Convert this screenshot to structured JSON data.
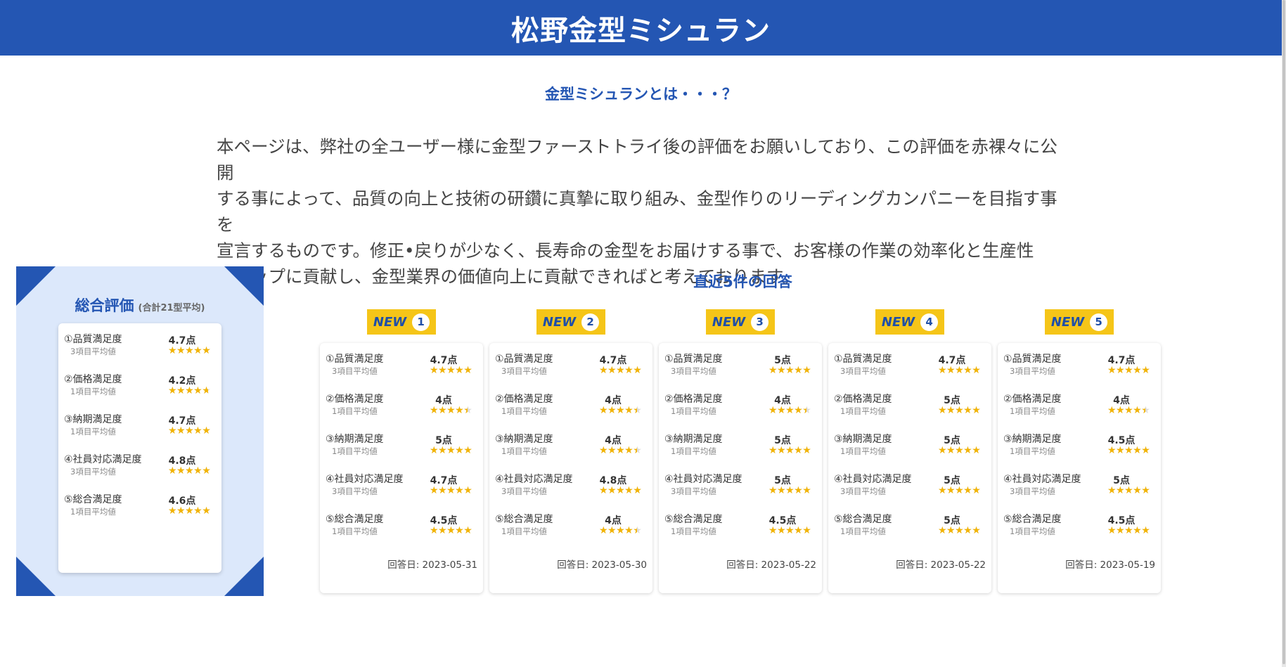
{
  "header": {
    "title": "松野金型ミシュラン"
  },
  "subtitle": "金型ミシュランとは・・・？",
  "intro": {
    "lines": [
      "本ページは、弊社の全ユーザー様に金型ファーストトライ後の評価をお願いしており、この評価を赤裸々に公開",
      "する事によって、品質の向上と技術の研鑽に真摯に取り組み、金型作りのリーディングカンパニーを目指す事を",
      "宣言するものです。修正•戻りが少なく、長寿命の金型をお届けする事で、お客様の作業の効率化と生産性",
      "のアップに貢献し、金型業界の価値向上に貢献できればと考えております。"
    ]
  },
  "overall": {
    "title": "総合評価",
    "note": "(合計21型平均)",
    "items": [
      {
        "label": "①品質満足度",
        "sub": "3項目平均値",
        "score": "4.7点",
        "value": 4.7
      },
      {
        "label": "②価格満足度",
        "sub": "1項目平均値",
        "score": "4.2点",
        "value": 4.2
      },
      {
        "label": "③納期満足度",
        "sub": "1項目平均値",
        "score": "4.7点",
        "value": 4.7
      },
      {
        "label": "④社員対応満足度",
        "sub": "3項目平均値",
        "score": "4.8点",
        "value": 4.8
      },
      {
        "label": "⑤総合満足度",
        "sub": "1項目平均値",
        "score": "4.6点",
        "value": 4.6
      }
    ]
  },
  "recent": {
    "title": "直近5件の回答",
    "new_label": "NEW",
    "cards": [
      {
        "num": "1",
        "date": "回答日: 2023-05-31",
        "items": [
          {
            "label": "①品質満足度",
            "sub": "3項目平均値",
            "score": "4.7点",
            "value": 4.7
          },
          {
            "label": "②価格満足度",
            "sub": "1項目平均値",
            "score": "4点",
            "value": 4
          },
          {
            "label": "③納期満足度",
            "sub": "1項目平均値",
            "score": "5点",
            "value": 5
          },
          {
            "label": "④社員対応満足度",
            "sub": "3項目平均値",
            "score": "4.7点",
            "value": 4.7
          },
          {
            "label": "⑤総合満足度",
            "sub": "1項目平均値",
            "score": "4.5点",
            "value": 4.5
          }
        ]
      },
      {
        "num": "2",
        "date": "回答日: 2023-05-30",
        "items": [
          {
            "label": "①品質満足度",
            "sub": "3項目平均値",
            "score": "4.7点",
            "value": 4.7
          },
          {
            "label": "②価格満足度",
            "sub": "1項目平均値",
            "score": "4点",
            "value": 4
          },
          {
            "label": "③納期満足度",
            "sub": "1項目平均値",
            "score": "4点",
            "value": 4
          },
          {
            "label": "④社員対応満足度",
            "sub": "3項目平均値",
            "score": "4.8点",
            "value": 4.8
          },
          {
            "label": "⑤総合満足度",
            "sub": "1項目平均値",
            "score": "4点",
            "value": 4
          }
        ]
      },
      {
        "num": "3",
        "date": "回答日: 2023-05-22",
        "items": [
          {
            "label": "①品質満足度",
            "sub": "3項目平均値",
            "score": "5点",
            "value": 5
          },
          {
            "label": "②価格満足度",
            "sub": "1項目平均値",
            "score": "4点",
            "value": 4
          },
          {
            "label": "③納期満足度",
            "sub": "1項目平均値",
            "score": "5点",
            "value": 5
          },
          {
            "label": "④社員対応満足度",
            "sub": "3項目平均値",
            "score": "5点",
            "value": 5
          },
          {
            "label": "⑤総合満足度",
            "sub": "1項目平均値",
            "score": "4.5点",
            "value": 4.5
          }
        ]
      },
      {
        "num": "4",
        "date": "回答日: 2023-05-22",
        "items": [
          {
            "label": "①品質満足度",
            "sub": "3項目平均値",
            "score": "4.7点",
            "value": 4.7
          },
          {
            "label": "②価格満足度",
            "sub": "1項目平均値",
            "score": "5点",
            "value": 5
          },
          {
            "label": "③納期満足度",
            "sub": "1項目平均値",
            "score": "5点",
            "value": 5
          },
          {
            "label": "④社員対応満足度",
            "sub": "3項目平均値",
            "score": "5点",
            "value": 5
          },
          {
            "label": "⑤総合満足度",
            "sub": "1項目平均値",
            "score": "5点",
            "value": 5
          }
        ]
      },
      {
        "num": "5",
        "date": "回答日: 2023-05-19",
        "items": [
          {
            "label": "①品質満足度",
            "sub": "3項目平均値",
            "score": "4.7点",
            "value": 4.7
          },
          {
            "label": "②価格満足度",
            "sub": "1項目平均値",
            "score": "4点",
            "value": 4
          },
          {
            "label": "③納期満足度",
            "sub": "1項目平均値",
            "score": "4.5点",
            "value": 4.5
          },
          {
            "label": "④社員対応満足度",
            "sub": "3項目平均値",
            "score": "5点",
            "value": 5
          },
          {
            "label": "⑤総合満足度",
            "sub": "1項目平均値",
            "score": "4.5点",
            "value": 4.5
          }
        ]
      }
    ]
  },
  "stars": {
    "max": 5,
    "glyph": "★"
  },
  "colors": {
    "brand": "#2456b3",
    "badge": "#f5c518",
    "star": "#f2b407",
    "star_empty": "#dcdcdc",
    "panel": "#dce8fb"
  }
}
